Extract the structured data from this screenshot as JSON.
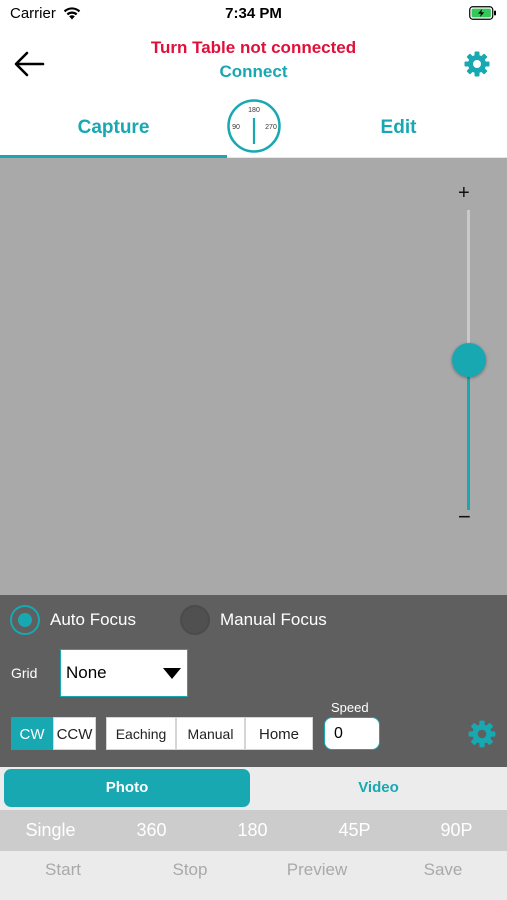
{
  "status_bar": {
    "carrier": "Carrier",
    "time": "7:34 PM"
  },
  "header": {
    "connection_status": "Turn Table not connected",
    "connect_label": "Connect"
  },
  "tabs": {
    "capture": "Capture",
    "edit": "Edit"
  },
  "dial": {
    "top": "180",
    "left": "90",
    "right": "270"
  },
  "zoom": {
    "plus": "+",
    "minus": "−",
    "level": 0.5
  },
  "focus": {
    "auto_label": "Auto Focus",
    "manual_label": "Manual Focus",
    "selected": "auto"
  },
  "grid": {
    "label": "Grid",
    "value": "None"
  },
  "rotation": {
    "cw": "CW",
    "ccw": "CCW",
    "selected": "cw"
  },
  "motion": {
    "eaching": "Eaching",
    "manual": "Manual",
    "home": "Home"
  },
  "speed": {
    "label": "Speed",
    "value": "0"
  },
  "capture_type": {
    "photo": "Photo",
    "video": "Video",
    "selected": "photo"
  },
  "shot_modes": [
    "Single",
    "360",
    "180",
    "45P",
    "90P"
  ],
  "actions": [
    "Start",
    "Stop",
    "Preview",
    "Save"
  ],
  "colors": {
    "accent": "#18a8b2",
    "alert": "#e0103a",
    "preview_bg": "#a9a9a9",
    "panel_bg": "#5f5f5f"
  },
  "icons": {
    "back": "arrow-left-icon",
    "settings": "gear-icon",
    "wifi": "wifi-icon",
    "battery": "battery-charging-icon",
    "dropdown": "caret-down-icon"
  }
}
